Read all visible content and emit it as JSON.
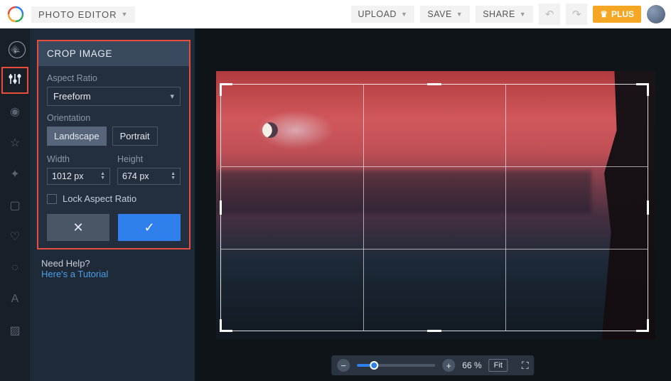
{
  "header": {
    "app_title": "PHOTO EDITOR",
    "upload": "UPLOAD",
    "save": "SAVE",
    "share": "SHARE",
    "plus_label": "PLUS"
  },
  "sidebar": {
    "tools": [
      {
        "name": "layers-icon"
      },
      {
        "name": "adjust-icon",
        "active": true
      },
      {
        "name": "eye-icon"
      },
      {
        "name": "star-icon"
      },
      {
        "name": "effects-icon"
      },
      {
        "name": "frame-icon"
      },
      {
        "name": "heart-icon"
      },
      {
        "name": "overlay-icon"
      },
      {
        "name": "text-icon"
      },
      {
        "name": "texture-icon"
      }
    ]
  },
  "panel": {
    "title": "CROP IMAGE",
    "aspect_label": "Aspect Ratio",
    "aspect_value": "Freeform",
    "orientation_label": "Orientation",
    "landscape": "Landscape",
    "portrait": "Portrait",
    "width_label": "Width",
    "width_value": "1012 px",
    "height_label": "Height",
    "height_value": "674 px",
    "lock_label": "Lock Aspect Ratio",
    "help_text": "Need Help?",
    "tutorial_link": "Here's a Tutorial"
  },
  "zoom": {
    "percent": "66 %",
    "fit": "Fit"
  }
}
